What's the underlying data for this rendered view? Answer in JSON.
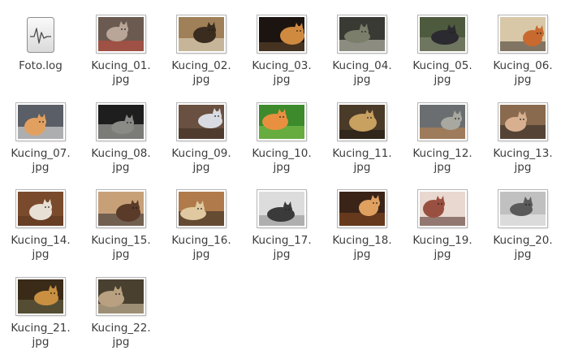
{
  "files": [
    {
      "line1": "Foto.log",
      "line2": "",
      "kind": "log",
      "icon": "log-file-icon"
    },
    {
      "line1": "Kucing_01.",
      "line2": "jpg",
      "kind": "image",
      "bg": "#6a5a50",
      "fg": "#b9a698",
      "acc": "#c94a3a"
    },
    {
      "line1": "Kucing_02.",
      "line2": "jpg",
      "kind": "image",
      "bg": "#a08058",
      "fg": "#3a2c1e",
      "acc": "#e8e0d0"
    },
    {
      "line1": "Kucing_03.",
      "line2": "jpg",
      "kind": "image",
      "bg": "#1c1410",
      "fg": "#d08a40",
      "acc": "#6a4a30"
    },
    {
      "line1": "Kucing_04.",
      "line2": "jpg",
      "kind": "image",
      "bg": "#3a3a34",
      "fg": "#7a7e6a",
      "acc": "#cfd2c0"
    },
    {
      "line1": "Kucing_05.",
      "line2": "jpg",
      "kind": "image",
      "bg": "#4e5a3e",
      "fg": "#2a2a30",
      "acc": "#8a8e7a"
    },
    {
      "line1": "Kucing_06.",
      "line2": "jpg",
      "kind": "image",
      "bg": "#d8c8a8",
      "fg": "#c86a30",
      "acc": "#3a3028"
    },
    {
      "line1": "Kucing_07.",
      "line2": "jpg",
      "kind": "image",
      "bg": "#5a5e66",
      "fg": "#e2a060",
      "acc": "#f2f0ec"
    },
    {
      "line1": "Kucing_08.",
      "line2": "jpg",
      "kind": "image",
      "bg": "#1e1e1e",
      "fg": "#8a8a86",
      "acc": "#c8c8c2"
    },
    {
      "line1": "Kucing_09.",
      "line2": "jpg",
      "kind": "image",
      "bg": "#6a5040",
      "fg": "#d8dce2",
      "acc": "#3a2a20"
    },
    {
      "line1": "Kucing_10.",
      "line2": "jpg",
      "kind": "image",
      "bg": "#3c8a2c",
      "fg": "#e89040",
      "acc": "#8ac850"
    },
    {
      "line1": "Kucing_11.",
      "line2": "jpg",
      "kind": "image",
      "bg": "#4a3a28",
      "fg": "#c8a060",
      "acc": "#1e1810"
    },
    {
      "line1": "Kucing_12.",
      "line2": "jpg",
      "kind": "image",
      "bg": "#6a6e70",
      "fg": "#a8a8a0",
      "acc": "#c8864a"
    },
    {
      "line1": "Kucing_13.",
      "line2": "jpg",
      "kind": "image",
      "bg": "#8a6a4e",
      "fg": "#d8b090",
      "acc": "#2a2420"
    },
    {
      "line1": "Kucing_14.",
      "line2": "jpg",
      "kind": "image",
      "bg": "#7a4a2c",
      "fg": "#e8e0d4",
      "acc": "#5a3420"
    },
    {
      "line1": "Kucing_15.",
      "line2": "jpg",
      "kind": "image",
      "bg": "#c8a078",
      "fg": "#5a3a28",
      "acc": "#2a2a30"
    },
    {
      "line1": "Kucing_16.",
      "line2": "jpg",
      "kind": "image",
      "bg": "#b07a4a",
      "fg": "#e0c8a0",
      "acc": "#2a2420"
    },
    {
      "line1": "Kucing_17.",
      "line2": "jpg",
      "kind": "image",
      "bg": "#dcdcdc",
      "fg": "#3a3a3a",
      "acc": "#8a8a8a"
    },
    {
      "line1": "Kucing_18.",
      "line2": "jpg",
      "kind": "image",
      "bg": "#3a2418",
      "fg": "#e0a060",
      "acc": "#8a4a20"
    },
    {
      "line1": "Kucing_19.",
      "line2": "jpg",
      "kind": "image",
      "bg": "#e8d8d0",
      "fg": "#9a5040",
      "acc": "#4a2a20"
    },
    {
      "line1": "Kucing_20.",
      "line2": "jpg",
      "kind": "image",
      "bg": "#c0c0c0",
      "fg": "#5a5a5a",
      "acc": "#f0f0f0"
    },
    {
      "line1": "Kucing_21.",
      "line2": "jpg",
      "kind": "image",
      "bg": "#3a2a18",
      "fg": "#c89040",
      "acc": "#6a6a4a"
    },
    {
      "line1": "Kucing_22.",
      "line2": "jpg",
      "kind": "image",
      "bg": "#4a4030",
      "fg": "#b8a080",
      "acc": "#e0d0b0"
    }
  ]
}
